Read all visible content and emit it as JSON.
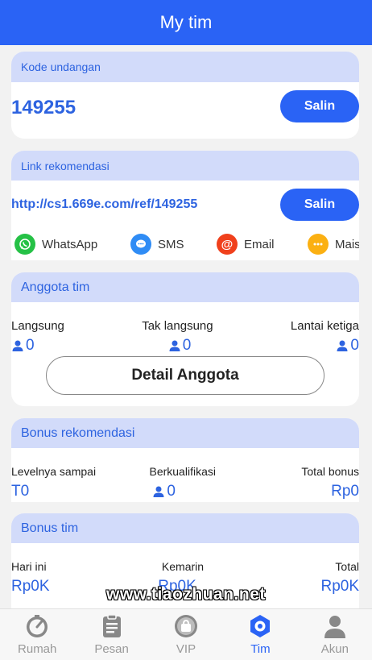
{
  "header": {
    "title": "My tim"
  },
  "invite": {
    "label": "Kode undangan",
    "code": "149255",
    "copy_label": "Salin"
  },
  "referral": {
    "label": "Link rekomendasi",
    "link": "http://cs1.669e.com/ref/149255",
    "copy_label": "Salin",
    "share": [
      {
        "label": "WhatsApp",
        "icon": "whatsapp-icon",
        "color": "#25c146"
      },
      {
        "label": "SMS",
        "icon": "sms-icon",
        "color": "#2f8cf5"
      },
      {
        "label": "Email",
        "icon": "email-icon",
        "color": "#f0401c"
      },
      {
        "label": "Mais",
        "icon": "more-icon",
        "color": "#fbb012"
      }
    ]
  },
  "team": {
    "title": "Anggota tim",
    "cols": [
      {
        "label": "Langsung",
        "value": "0"
      },
      {
        "label": "Tak langsung",
        "value": "0"
      },
      {
        "label": "Lantai ketiga",
        "value": "0"
      }
    ],
    "detail_button": "Detail Anggota"
  },
  "bonus_ref": {
    "title": "Bonus rekomendasi",
    "cols": [
      {
        "label": "Levelnya sampai",
        "value": "T0"
      },
      {
        "label": "Berkualifikasi",
        "value": "0"
      },
      {
        "label": "Total bonus",
        "value": "Rp0"
      }
    ]
  },
  "bonus_team": {
    "title": "Bonus tim",
    "cols": [
      {
        "label": "Hari ini",
        "value": "Rp0K"
      },
      {
        "label": "Kemarin",
        "value": "Rp0K"
      },
      {
        "label": "Total",
        "value": "Rp0K"
      }
    ]
  },
  "tabbar": [
    {
      "label": "Rumah",
      "icon": "gauge-icon"
    },
    {
      "label": "Pesan",
      "icon": "clipboard-icon"
    },
    {
      "label": "VIP",
      "icon": "vip-bag-icon"
    },
    {
      "label": "Tim",
      "icon": "team-hex-icon",
      "active": true
    },
    {
      "label": "Akun",
      "icon": "user-icon"
    }
  ],
  "watermark": "www.tiaozhuan.net",
  "colors": {
    "accent": "#2a63f5",
    "section_head": "#d2dbfa",
    "text_blue": "#2d63e0"
  }
}
